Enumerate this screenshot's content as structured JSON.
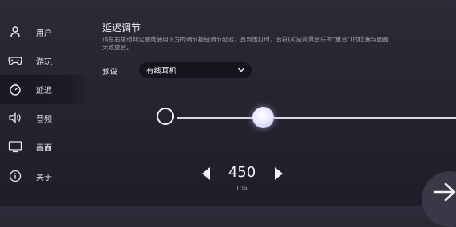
{
  "sidebar": {
    "items": [
      {
        "label": "用户",
        "icon": "user-icon"
      },
      {
        "label": "游玩",
        "icon": "gamepad-icon"
      },
      {
        "label": "延迟",
        "icon": "timer-icon"
      },
      {
        "label": "音频",
        "icon": "speaker-icon"
      },
      {
        "label": "画面",
        "icon": "monitor-icon"
      },
      {
        "label": "关于",
        "icon": "info-icon"
      }
    ],
    "active_index": 2
  },
  "main": {
    "title": "延迟调节",
    "description": "请左右拨动判定圈或使用下方的调节按钮调节延迟，直到击打时，音符(对应背景音乐的“重音”)的位置与圆圈大致重合。",
    "preset": {
      "label": "预设",
      "value": "有线耳机"
    },
    "latency": {
      "value": "450",
      "unit": "ms"
    }
  },
  "colors": {
    "background": "#2a2733",
    "active_item_bg": "#1a1821",
    "text": "#e8e6ee"
  }
}
